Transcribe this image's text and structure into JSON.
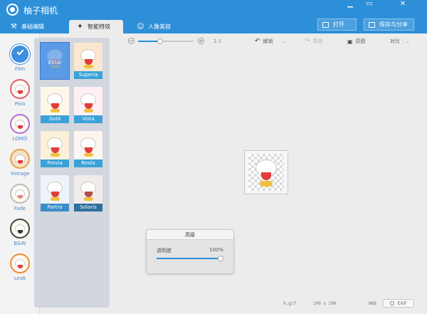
{
  "app": {
    "title": "柚子相机"
  },
  "window_buttons": {
    "minimize": "▁",
    "restore": "▭",
    "close": "✕"
  },
  "tabs": [
    {
      "label": "基础编辑",
      "icon": "wrench-icon",
      "active": false
    },
    {
      "label": "智能特效",
      "icon": "magic-wand-icon",
      "active": true
    },
    {
      "label": "人像美容",
      "icon": "face-beauty-icon",
      "active": false
    }
  ],
  "header_buttons": {
    "open": "打开",
    "save_share": "保存与分享"
  },
  "categories": [
    {
      "label": "Film",
      "selected": true
    },
    {
      "label": "Pola",
      "selected": false
    },
    {
      "label": "LOMO",
      "selected": false
    },
    {
      "label": "Vintage",
      "selected": false
    },
    {
      "label": "Fade",
      "selected": false
    },
    {
      "label": "B&W",
      "selected": false
    },
    {
      "label": "Leak",
      "selected": false
    }
  ],
  "filters": [
    {
      "label": "Ektar",
      "selected": true
    },
    {
      "label": "Superia",
      "selected": false
    },
    {
      "label": "Gold",
      "selected": false
    },
    {
      "label": "Vista",
      "selected": false
    },
    {
      "label": "Provia",
      "selected": false
    },
    {
      "label": "Reala",
      "selected": false
    },
    {
      "label": "Portra",
      "selected": false
    },
    {
      "label": "Solaris",
      "selected": false
    }
  ],
  "toolbar": {
    "zoom_ratio": "1:1",
    "zoom_level": 0.4,
    "undo": "撤销",
    "redo": "重做",
    "original": "原图",
    "compare": "对比"
  },
  "advanced": {
    "title": "高级",
    "opacity_label": "透明度",
    "opacity_value": "100%",
    "opacity_level": 1.0
  },
  "status": {
    "filename": "9.gif",
    "dimensions": "100 x 100",
    "filesize": "8KB",
    "exif_label": "EXIF"
  }
}
